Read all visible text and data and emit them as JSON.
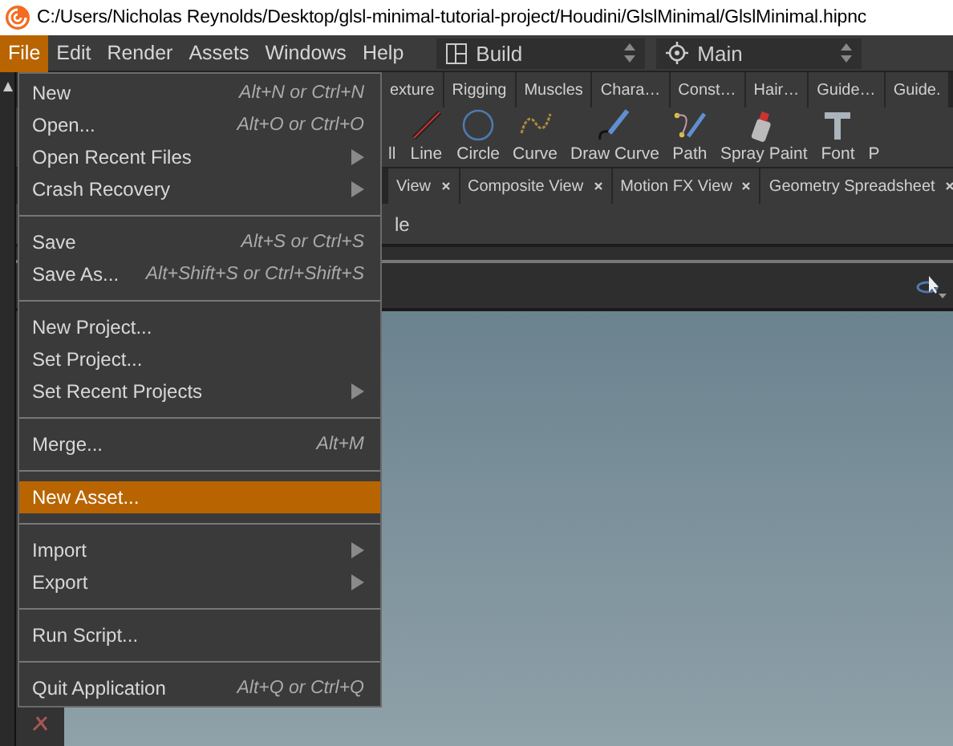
{
  "title_bar": {
    "path": "C:/Users/Nicholas Reynolds/Desktop/glsl-minimal-tutorial-project/Houdini/GlslMinimal/GlslMinimal.hipnc"
  },
  "menu_bar": {
    "items": [
      {
        "label": "File",
        "selected": true
      },
      {
        "label": "Edit",
        "selected": false
      },
      {
        "label": "Render",
        "selected": false
      },
      {
        "label": "Assets",
        "selected": false
      },
      {
        "label": "Windows",
        "selected": false
      },
      {
        "label": "Help",
        "selected": false
      }
    ]
  },
  "desktop_selector": {
    "label": "Build"
  },
  "viewport_selector": {
    "label": "Main"
  },
  "shelf_tabs": [
    {
      "label": "exture"
    },
    {
      "label": "Rigging"
    },
    {
      "label": "Muscles"
    },
    {
      "label": "Chara…"
    },
    {
      "label": "Const…"
    },
    {
      "label": "Hair…"
    },
    {
      "label": "Guide…"
    },
    {
      "label": "Guide."
    }
  ],
  "shelf_tools": [
    {
      "label": "ll",
      "kind": "partial"
    },
    {
      "label": "Line",
      "kind": "line"
    },
    {
      "label": "Circle",
      "kind": "circle"
    },
    {
      "label": "Curve",
      "kind": "curve"
    },
    {
      "label": "Draw Curve",
      "kind": "draw"
    },
    {
      "label": "Path",
      "kind": "path"
    },
    {
      "label": "Spray Paint",
      "kind": "spray"
    },
    {
      "label": "Font",
      "kind": "font"
    },
    {
      "label": "P",
      "kind": "partial"
    }
  ],
  "pane_tabs": [
    {
      "label": "View"
    },
    {
      "label": "Composite View"
    },
    {
      "label": "Motion FX View"
    },
    {
      "label": "Geometry Spreadsheet"
    }
  ],
  "pane_row": {
    "label": "le"
  },
  "file_menu": {
    "items": [
      {
        "kind": "item",
        "label": "New",
        "shortcut": "Alt+N or Ctrl+N",
        "submenu": false,
        "selected": false
      },
      {
        "kind": "item",
        "label": "Open...",
        "shortcut": "Alt+O or Ctrl+O",
        "submenu": false,
        "selected": false
      },
      {
        "kind": "item",
        "label": "Open Recent Files",
        "submenu": true,
        "selected": false
      },
      {
        "kind": "item",
        "label": "Crash Recovery",
        "submenu": true,
        "selected": false
      },
      {
        "kind": "separator"
      },
      {
        "kind": "item",
        "label": "Save",
        "shortcut": "Alt+S or Ctrl+S",
        "submenu": false,
        "selected": false
      },
      {
        "kind": "item",
        "label": "Save As...",
        "shortcut": "Alt+Shift+S or Ctrl+Shift+S",
        "submenu": false,
        "selected": false
      },
      {
        "kind": "separator"
      },
      {
        "kind": "item",
        "label": "New Project...",
        "submenu": false,
        "selected": false
      },
      {
        "kind": "item",
        "label": "Set Project...",
        "submenu": false,
        "selected": false
      },
      {
        "kind": "item",
        "label": "Set Recent Projects",
        "submenu": true,
        "selected": false
      },
      {
        "kind": "separator"
      },
      {
        "kind": "item",
        "label": "Merge...",
        "shortcut": "Alt+M",
        "submenu": false,
        "selected": false
      },
      {
        "kind": "separator"
      },
      {
        "kind": "item",
        "label": "New Asset...",
        "submenu": false,
        "selected": true
      },
      {
        "kind": "separator"
      },
      {
        "kind": "item",
        "label": "Import",
        "submenu": true,
        "selected": false
      },
      {
        "kind": "item",
        "label": "Export",
        "submenu": true,
        "selected": false
      },
      {
        "kind": "separator"
      },
      {
        "kind": "item",
        "label": "Run Script...",
        "submenu": false,
        "selected": false
      },
      {
        "kind": "separator"
      },
      {
        "kind": "item",
        "label": "Quit Application",
        "shortcut": "Alt+Q or Ctrl+Q",
        "submenu": false,
        "selected": false
      }
    ]
  }
}
